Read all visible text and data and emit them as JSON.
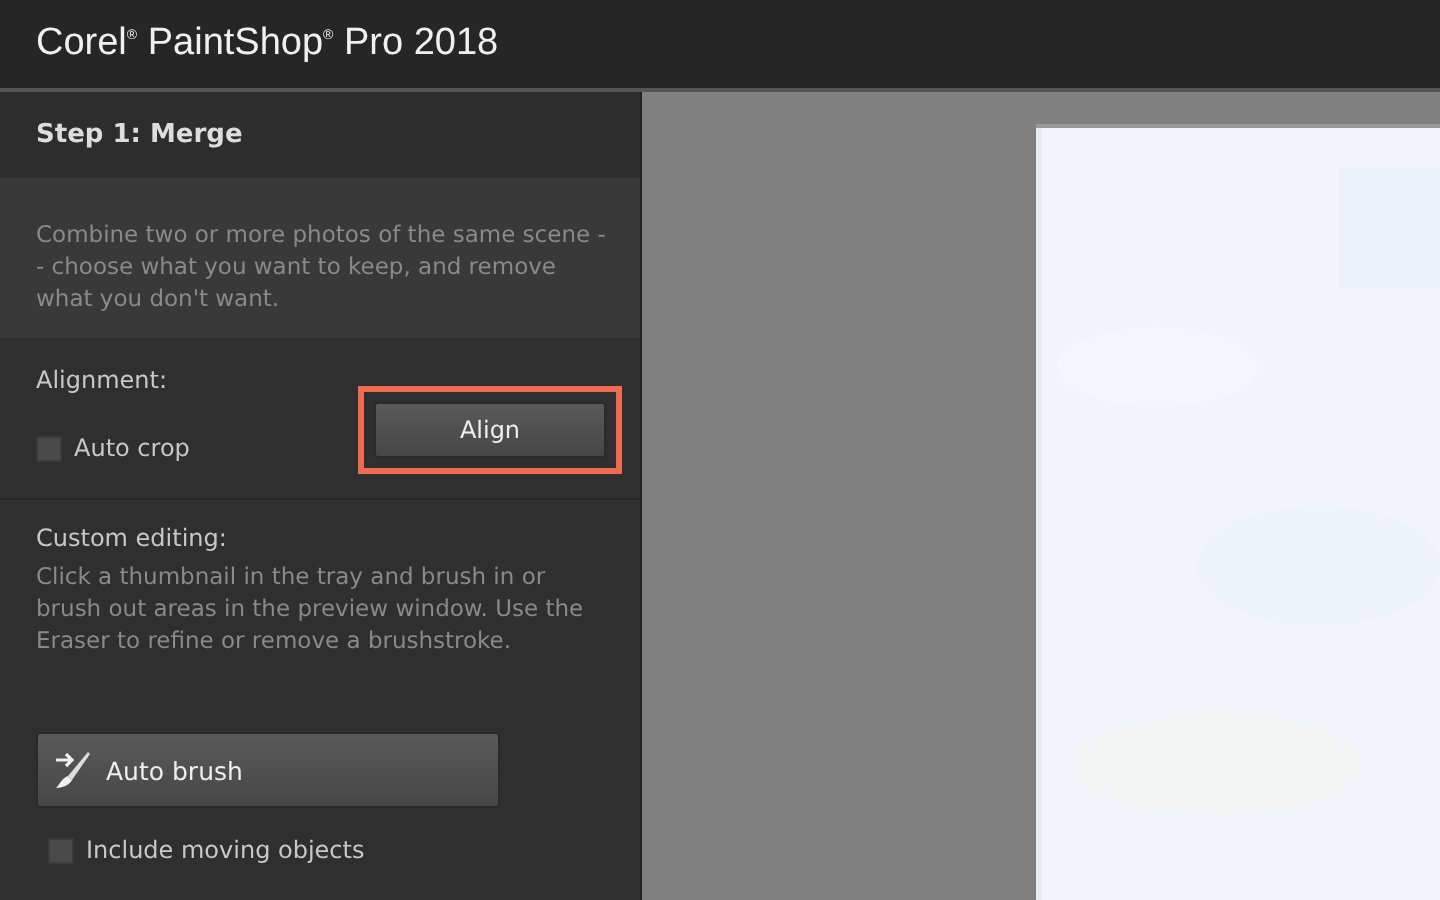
{
  "window": {
    "title": "Corel$^{®}$ PaintShop$^{®}$ Pro 2018"
  },
  "panel": {
    "step_title": "Step 1: Merge",
    "description": "Combine two or more photos of the same scene -- choose what you want to keep, and remove what you don't want.",
    "alignment": {
      "label": "Alignment:",
      "auto_crop": {
        "label": "Auto crop",
        "checked": false
      },
      "align_button": {
        "label": "Align",
        "highlighted": true
      }
    },
    "custom_editing": {
      "label": "Custom editing:",
      "instructions": "Click a thumbnail in the tray and brush in or brush out areas in the preview window. Use the Eraser to refine or remove a brushstroke.",
      "auto_brush_button": {
        "label": "Auto brush"
      },
      "include_moving": {
        "label": "Include moving objects",
        "checked": false
      }
    }
  }
}
